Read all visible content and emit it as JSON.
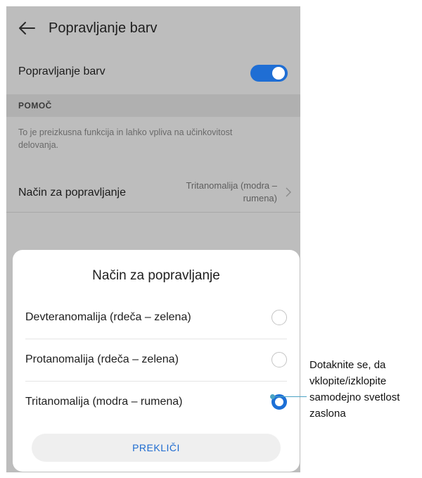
{
  "screen": {
    "title": "Popravljanje barv",
    "back_icon": "arrow-left-icon"
  },
  "toggle_row": {
    "label": "Popravljanje barv",
    "state": "on",
    "accent": "#1f6ed4"
  },
  "section": {
    "header": "POMOČ",
    "help_text": "To je preizkusna funkcija in lahko vpliva na učinkovitost delovanja."
  },
  "method_row": {
    "label": "Način za popravljanje",
    "value_line1": "Tritanomalija (modra –",
    "value_line2": "rumena)"
  },
  "dialog": {
    "title": "Način za popravljanje",
    "options": [
      {
        "label": "Devteranomalija (rdeča – zelena)",
        "selected": false
      },
      {
        "label": "Protanomalija (rdeča – zelena)",
        "selected": false
      },
      {
        "label": "Tritanomalija (modra – rumena)",
        "selected": true
      }
    ],
    "cancel_label": "PREKLIČI"
  },
  "callout": {
    "lines": [
      "Dotaknite se, da",
      "vklopite/izklopite",
      "samodejno svetlost",
      "zaslona"
    ]
  }
}
